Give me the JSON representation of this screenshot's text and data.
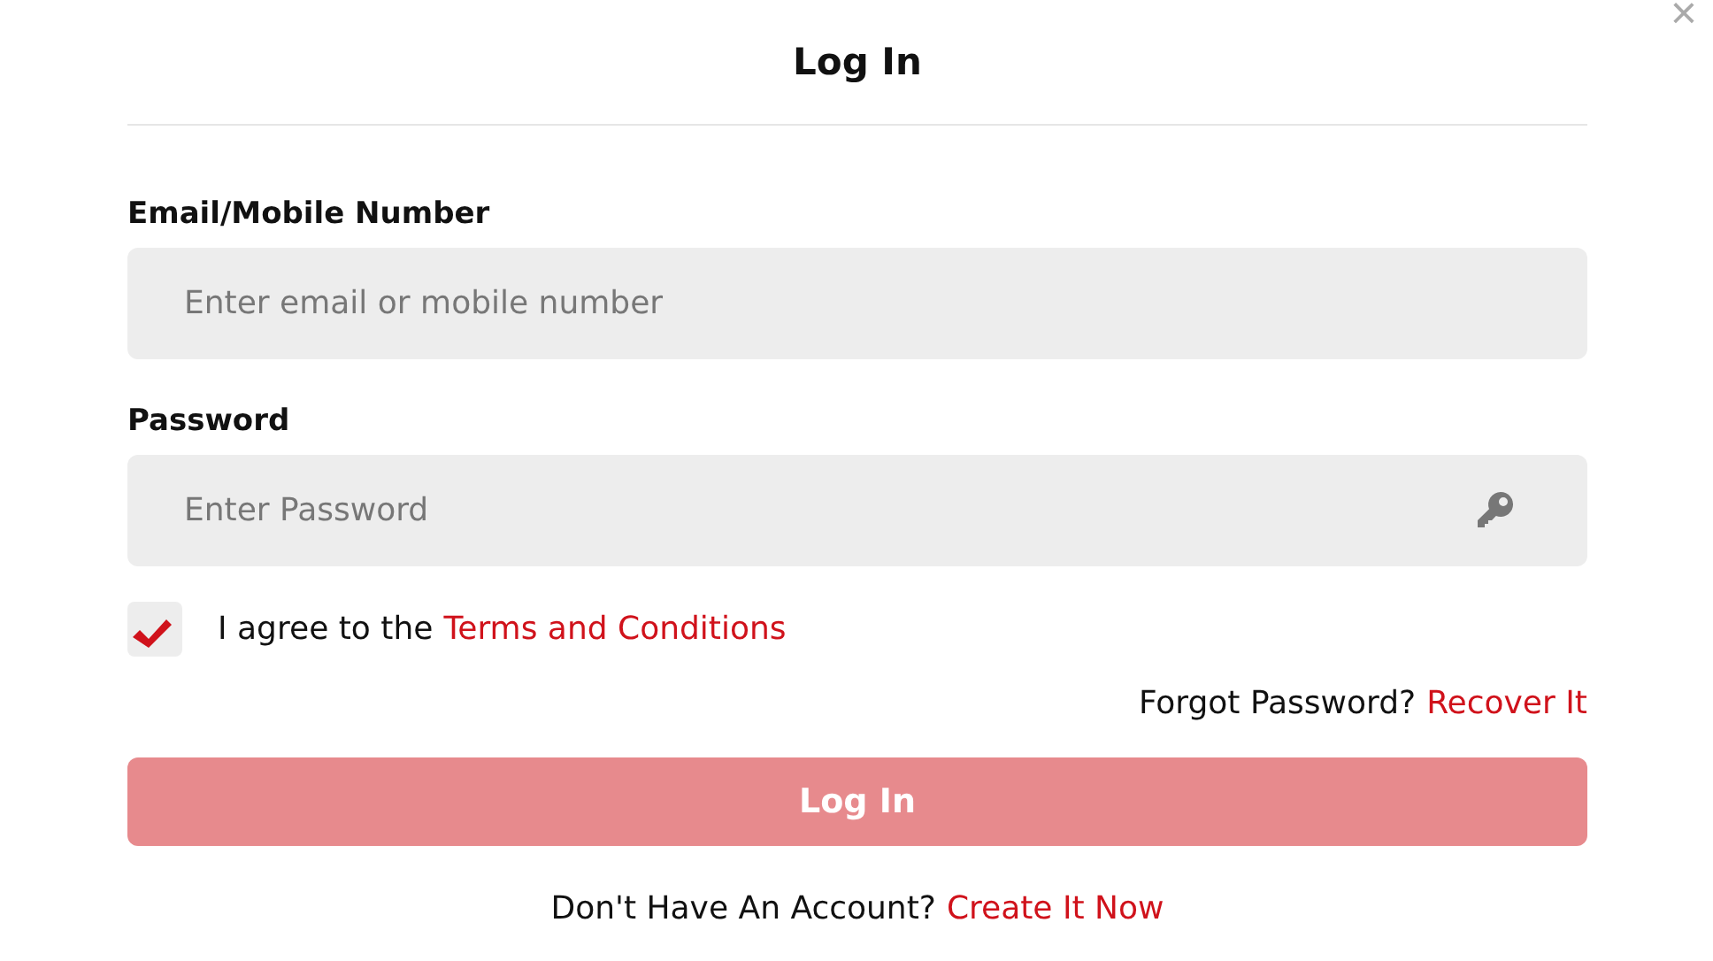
{
  "dialog": {
    "title": "Log In",
    "close": "×"
  },
  "fields": [
    {
      "label": "Email/Mobile Number",
      "placeholder": "Enter email or mobile number",
      "kind": "text"
    },
    {
      "label": "Password",
      "placeholder": "Enter Password",
      "kind": "password"
    }
  ],
  "agree": {
    "checked": true,
    "text": "I agree to the",
    "link": "Terms and Conditions"
  },
  "forgot": {
    "text": "Forgot Password?",
    "link": "Recover It"
  },
  "submit": {
    "label": "Log In",
    "disabled": true
  },
  "signup": {
    "text": "Don't Have An Account?",
    "link": "Create It Now"
  }
}
